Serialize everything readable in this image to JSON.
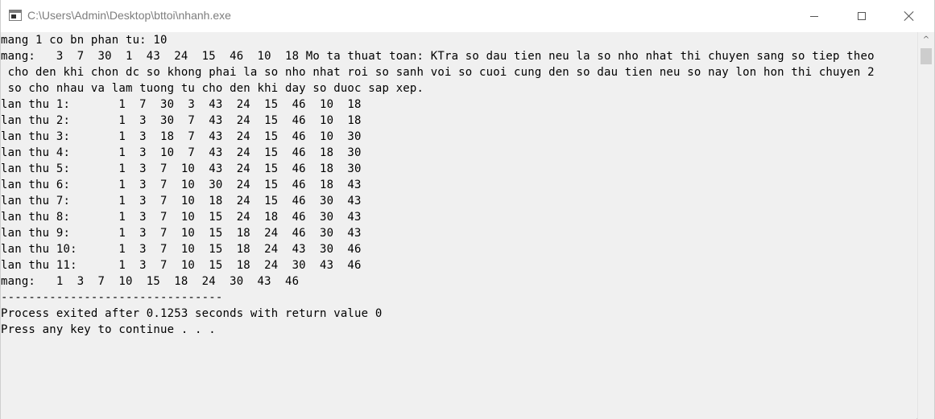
{
  "window": {
    "title": "C:\\Users\\Admin\\Desktop\\bttoi\\nhanh.exe",
    "minimize_label": "",
    "maximize_label": "",
    "close_label": ""
  },
  "scrollbar": {
    "up_arrow": "^"
  },
  "console": {
    "lines": [
      "mang 1 co bn phan tu: 10",
      "mang:   3  7  30  1  43  24  15  46  10  18 Mo ta thuat toan: KTra so dau tien neu la so nho nhat thi chuyen sang so tiep theo",
      " cho den khi chon dc so khong phai la so nho nhat roi so sanh voi so cuoi cung den so dau tien neu so nay lon hon thi chuyen 2",
      " so cho nhau va lam tuong tu cho den khi day so duoc sap xep.",
      "lan thu 1:       1  7  30  3  43  24  15  46  10  18",
      "lan thu 2:       1  3  30  7  43  24  15  46  10  18",
      "lan thu 3:       1  3  18  7  43  24  15  46  10  30",
      "lan thu 4:       1  3  10  7  43  24  15  46  18  30",
      "lan thu 5:       1  3  7  10  43  24  15  46  18  30",
      "lan thu 6:       1  3  7  10  30  24  15  46  18  43",
      "lan thu 7:       1  3  7  10  18  24  15  46  30  43",
      "lan thu 8:       1  3  7  10  15  24  18  46  30  43",
      "lan thu 9:       1  3  7  10  15  18  24  46  30  43",
      "lan thu 10:      1  3  7  10  15  18  24  43  30  46",
      "lan thu 11:      1  3  7  10  15  18  24  30  43  46",
      "mang:   1  3  7  10  15  18  24  30  43  46",
      "--------------------------------",
      "Process exited after 0.1253 seconds with return value 0",
      "Press any key to continue . . ."
    ]
  }
}
